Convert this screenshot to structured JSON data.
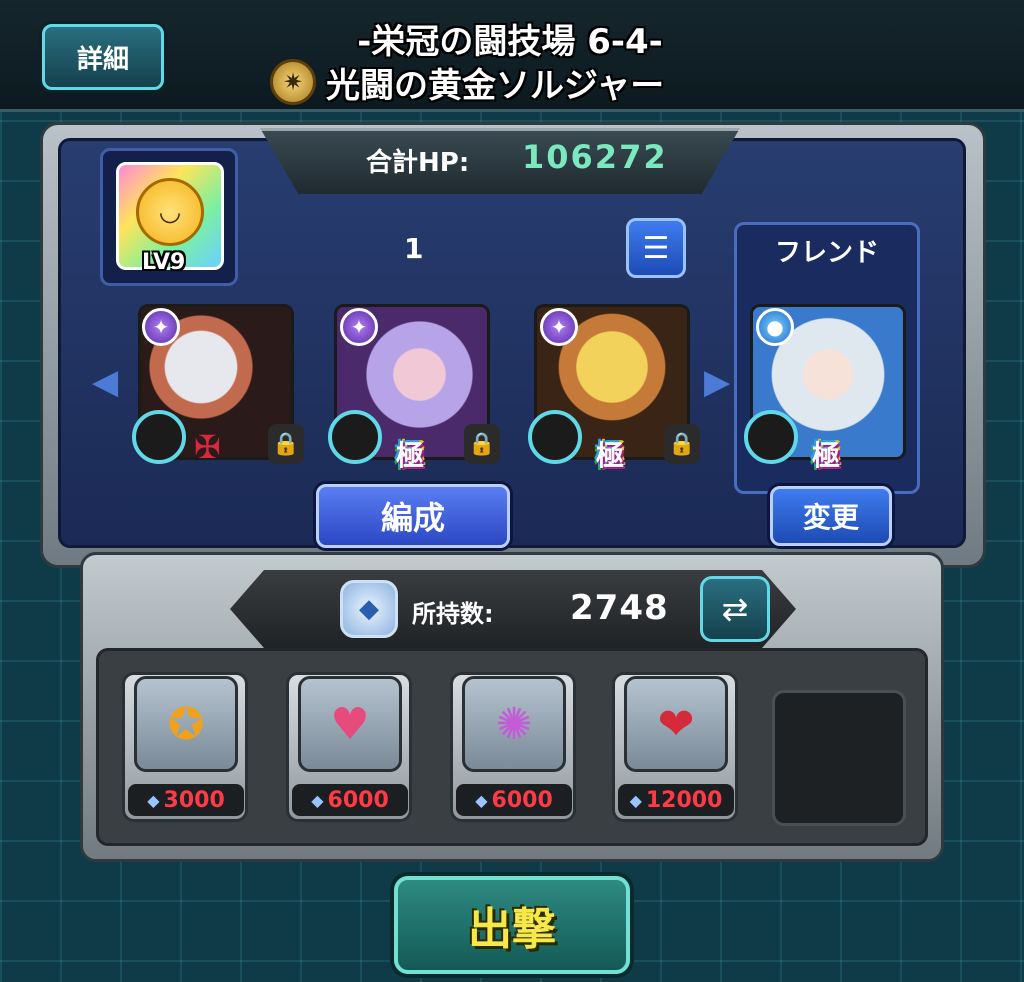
{
  "header": {
    "detail_button": "詳細",
    "stage_title": "-栄冠の闘技場 6-4-",
    "quest_name": "光闘の黄金ソルジャー"
  },
  "party": {
    "total_hp_label": "合計HP:",
    "total_hp_value": "106272",
    "helper_level": "LV9",
    "party_number": "1",
    "friend_label": "フレンド",
    "team_button": "編成",
    "change_button": "変更",
    "gauge_badge": "極"
  },
  "items": {
    "owned_label": "所持数:",
    "owned_value": "2748",
    "prices": [
      "3000",
      "6000",
      "6000",
      "12000"
    ]
  },
  "sortie_button": "出撃",
  "icons": {
    "element_badge": "light-element-icon",
    "list": "list-icon",
    "swap": "swap-arrows-icon",
    "lock": "lock-icon"
  }
}
